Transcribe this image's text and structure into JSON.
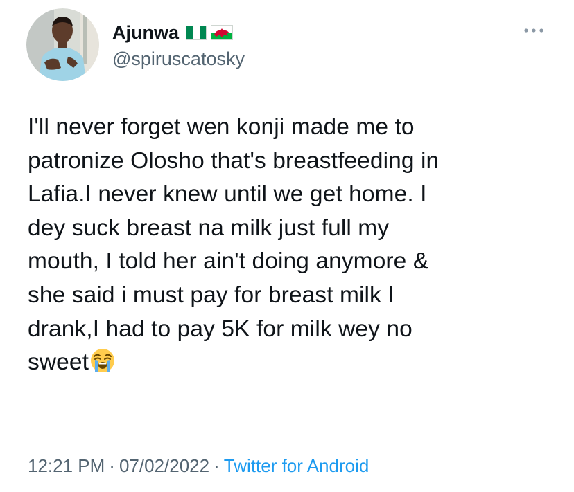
{
  "author": {
    "display_name": "Ajunwa",
    "handle": "@spiruscatosky",
    "flags": [
      "nigeria-flag",
      "wales-flag"
    ]
  },
  "tweet": {
    "text": "I'll never forget wen konji made me to\npatronize Olosho that's breastfeeding in\nLafia.I never knew until we get home. I\ndey suck breast na milk just full my\nmouth, I told her ain't doing anymore &\nshe said i must pay for breast milk I\ndrank,I had to pay 5K for milk wey no\nsweet",
    "emoji": "loudly-crying-face"
  },
  "meta": {
    "time": "12:21 PM",
    "separator": "·",
    "date": "07/02/2022",
    "source": "Twitter for Android"
  },
  "colors": {
    "text": "#0f1419",
    "secondary": "#536471",
    "link": "#1d9bf0"
  },
  "icons": {
    "more": "more-dots-icon"
  }
}
